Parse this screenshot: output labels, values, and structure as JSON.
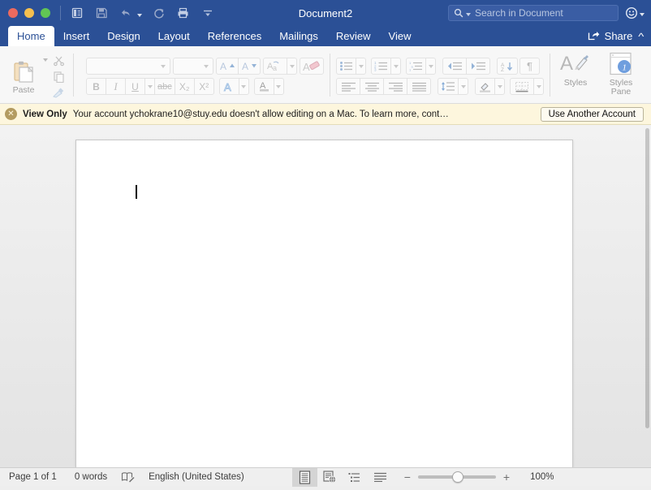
{
  "titlebar": {
    "document_title": "Document2",
    "window_controls": [
      "close",
      "minimize",
      "maximize"
    ],
    "quick_access": [
      {
        "name": "print-layout-view-icon",
        "label": "Print Layout View"
      },
      {
        "name": "save-icon",
        "label": "Save"
      },
      {
        "name": "undo-icon",
        "label": "Undo"
      },
      {
        "name": "redo-icon",
        "label": "Redo"
      },
      {
        "name": "print-icon",
        "label": "Print"
      },
      {
        "name": "customize-toolbar-icon",
        "label": "Customize Toolbar"
      }
    ],
    "search": {
      "placeholder": "Search in Document",
      "value": ""
    },
    "feedback_icon": "smiley-icon"
  },
  "tabs": {
    "items": [
      {
        "label": "Home",
        "active": true
      },
      {
        "label": "Insert",
        "active": false
      },
      {
        "label": "Design",
        "active": false
      },
      {
        "label": "Layout",
        "active": false
      },
      {
        "label": "References",
        "active": false
      },
      {
        "label": "Mailings",
        "active": false
      },
      {
        "label": "Review",
        "active": false
      },
      {
        "label": "View",
        "active": false
      }
    ],
    "share_label": "Share",
    "collapse_ribbon_icon": "chevron-up-icon"
  },
  "ribbon": {
    "clipboard": {
      "paste_label": "Paste",
      "cut_label": "Cut",
      "copy_label": "Copy",
      "format_painter_label": "Format Painter"
    },
    "font": {
      "font_name_value": "",
      "font_size_value": "",
      "grow_font_label": "Grow Font",
      "shrink_font_label": "Shrink Font",
      "change_case_label": "Change Case",
      "clear_formatting_label": "Clear Formatting",
      "bold_label": "B",
      "italic_label": "I",
      "underline_label": "U",
      "strikethrough_label": "abc",
      "subscript_label": "X₂",
      "superscript_label": "X²",
      "text_effects_label": "Text Effects",
      "font_color_label": "Font Color"
    },
    "paragraph": {
      "bullets_label": "Bullets",
      "numbering_label": "Numbering",
      "multilevel_label": "Multilevel List",
      "decrease_indent_label": "Decrease Indent",
      "increase_indent_label": "Increase Indent",
      "sort_label": "Sort",
      "show_marks_label": "¶",
      "align_left_label": "Align Left",
      "align_center_label": "Center",
      "align_right_label": "Align Right",
      "justify_label": "Justify",
      "line_spacing_label": "Line Spacing",
      "shading_label": "Shading",
      "borders_label": "Borders"
    },
    "styles": {
      "styles_label": "Styles",
      "styles_pane_label": "Styles\nPane",
      "styles_pane_line1": "Styles",
      "styles_pane_line2": "Pane"
    }
  },
  "notification": {
    "close_icon": "close-circle-icon",
    "title": "View Only",
    "message": "Your account ychokrane10@stuy.edu doesn't allow editing on a Mac. To learn more, cont…",
    "button_label": "Use Another Account",
    "background_color": "#fdf6dd"
  },
  "document": {
    "page_background": "#ffffff",
    "cursor_visible": true,
    "content": ""
  },
  "statusbar": {
    "page_indicator": "Page 1 of 1",
    "word_count": "0 words",
    "proofing_icon": "proofing-language-icon",
    "language": "English (United States)",
    "views": [
      {
        "name": "print-layout",
        "label": "Print Layout",
        "active": true
      },
      {
        "name": "web-layout",
        "label": "Web Layout",
        "active": false
      },
      {
        "name": "outline",
        "label": "Outline",
        "active": false
      },
      {
        "name": "draft",
        "label": "Draft",
        "active": false
      }
    ],
    "zoom_out_label": "−",
    "zoom_in_label": "+",
    "zoom_percent": "100%",
    "zoom_value": 100
  },
  "colors": {
    "titlebar": "#2b5096",
    "ribbon": "#f7f7f7",
    "notice": "#fdf6dd",
    "accent": "#2b5096"
  }
}
